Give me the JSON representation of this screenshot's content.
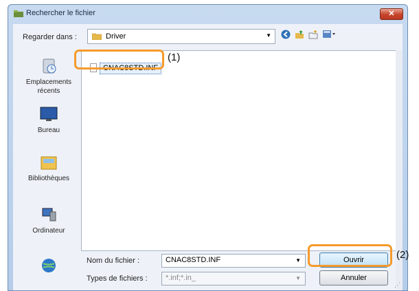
{
  "window": {
    "title": "Rechercher le fichier",
    "close_label": "✕"
  },
  "toolbar": {
    "look_in_label": "Regarder dans :",
    "look_in_value": "Driver",
    "icons": [
      "back-icon",
      "up-folder-icon",
      "new-folder-icon",
      "view-menu-icon"
    ]
  },
  "places": [
    {
      "label": "Emplacements récents",
      "icon": "recent-places-icon"
    },
    {
      "label": "Bureau",
      "icon": "desktop-icon"
    },
    {
      "label": "Bibliothèques",
      "icon": "libraries-icon"
    },
    {
      "label": "Ordinateur",
      "icon": "computer-icon"
    },
    {
      "label": "",
      "icon": "network-icon"
    }
  ],
  "files": [
    {
      "name": "CNAC8STD.INF"
    }
  ],
  "annotations": {
    "callout1": "(1)",
    "callout2": "(2)",
    "highlight_color": "#f59a2c"
  },
  "filename": {
    "label": "Nom du fichier :",
    "value": "CNAC8STD.INF"
  },
  "filetype": {
    "label": "Types de fichiers :",
    "value": "*.inf;*.in_"
  },
  "buttons": {
    "open": "Ouvrir",
    "cancel": "Annuler"
  }
}
